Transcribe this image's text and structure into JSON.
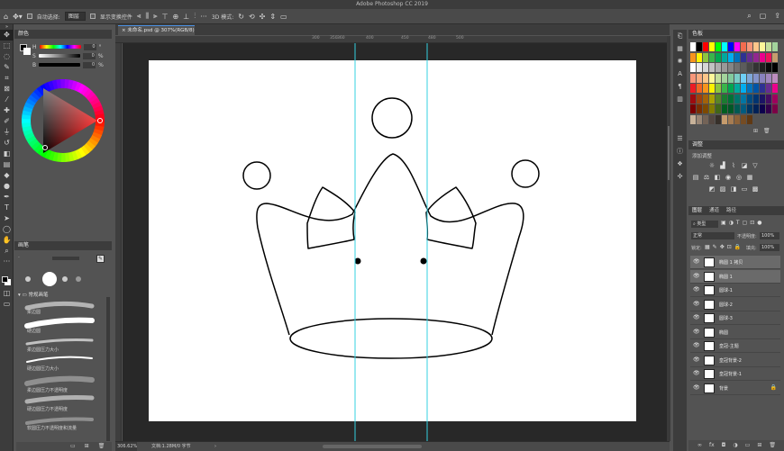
{
  "app": {
    "title": "Adobe Photoshop CC 2019"
  },
  "options_bar": {
    "auto_select_label": "自动选择:",
    "auto_select_value": "图层",
    "show_transform_label": "显示变换控件",
    "mode_3d_label": "3D 模式:"
  },
  "document": {
    "tab_title": "未命名.psd @ 307%(RGB/8) *",
    "zoom": "306.62%",
    "doc_info": "文档:1.28M/0 字节",
    "ruler_labels": [
      "300",
      "350",
      "360",
      "400",
      "450",
      "480",
      "500"
    ]
  },
  "color_panel": {
    "title": "颜色",
    "sliders": [
      {
        "letter": "H",
        "value": "0",
        "unit": "°"
      },
      {
        "letter": "S",
        "value": "0",
        "unit": "%"
      },
      {
        "letter": "B",
        "value": "0",
        "unit": "%"
      }
    ]
  },
  "brush_panel": {
    "title": "画笔",
    "group_name": "常规画笔",
    "brushes": [
      "柔边圆",
      "硬边圆",
      "柔边圆压力大小",
      "硬边圆压力大小",
      "柔边圆压力不透明度",
      "硬边圆压力不透明度",
      "软圆压力不透明度和流量"
    ]
  },
  "swatches_panel": {
    "title": "色板",
    "colors": [
      "#ffffff",
      "#000000",
      "#ff0000",
      "#ffff00",
      "#00ff00",
      "#00ffff",
      "#0000ff",
      "#ff00ff",
      "#f26c4f",
      "#f69679",
      "#fdc68a",
      "#fff799",
      "#c4df9b",
      "#a3d39c",
      "#f7941d",
      "#fff200",
      "#8dc63f",
      "#39b54a",
      "#00a651",
      "#00a99d",
      "#00aeef",
      "#0072bc",
      "#2e3192",
      "#662d91",
      "#92278f",
      "#ec008c",
      "#ed145b",
      "#c69c6d",
      "#ffffff",
      "#ebebeb",
      "#d7d7d7",
      "#c2c2c2",
      "#adadad",
      "#999999",
      "#858585",
      "#707070",
      "#5c5c5c",
      "#474747",
      "#333333",
      "#1f1f1f",
      "#0a0a0a",
      "#000000",
      "#f7977a",
      "#f9ad81",
      "#fdc68a",
      "#fff79a",
      "#c4df9b",
      "#a3d39c",
      "#82ca9d",
      "#7bcdc8",
      "#6ecff6",
      "#7ea7d8",
      "#8493ca",
      "#8882be",
      "#a187be",
      "#bc8dbf",
      "#ed1c24",
      "#f26522",
      "#f7941d",
      "#fff200",
      "#8dc63f",
      "#39b54a",
      "#00a651",
      "#00a99d",
      "#00aeef",
      "#0072bc",
      "#0054a6",
      "#2e3192",
      "#662d91",
      "#ec008c",
      "#9e0b0f",
      "#a0410d",
      "#a36209",
      "#aba000",
      "#598527",
      "#1a7b30",
      "#007236",
      "#00746b",
      "#0076a3",
      "#004b80",
      "#003471",
      "#1b1464",
      "#440e62",
      "#9e005d",
      "#790000",
      "#7b2e00",
      "#7d4900",
      "#827b00",
      "#406618",
      "#005e20",
      "#005826",
      "#005952",
      "#005b7f",
      "#003663",
      "#002157",
      "#0d004c",
      "#32004b",
      "#7b0046",
      "#c7b299",
      "#998675",
      "#736357",
      "#534741",
      "#37302a",
      "#c69c6d",
      "#a67c52",
      "#8c6239",
      "#754c24",
      "#603913"
    ]
  },
  "adjustments_panel": {
    "title": "调整",
    "subtitle": "添加调整"
  },
  "layers_panel": {
    "tabs": [
      "图层",
      "通道",
      "路径"
    ],
    "kind_filter": "类型",
    "blend_mode": "正常",
    "opacity_label": "不透明度:",
    "opacity_value": "100%",
    "lock_label": "锁定:",
    "fill_label": "填充:",
    "fill_value": "100%",
    "layers": [
      {
        "name": "椭圆 1 拷贝",
        "selected": true,
        "locked": false
      },
      {
        "name": "椭圆 1",
        "selected": true,
        "locked": false
      },
      {
        "name": "圆球-1",
        "selected": false,
        "locked": false
      },
      {
        "name": "圆球-2",
        "selected": false,
        "locked": false
      },
      {
        "name": "圆球-3",
        "selected": false,
        "locked": false
      },
      {
        "name": "椭圆",
        "selected": false,
        "locked": false
      },
      {
        "name": "皇冠-主题",
        "selected": false,
        "locked": false
      },
      {
        "name": "皇冠背景-2",
        "selected": false,
        "locked": false
      },
      {
        "name": "皇冠背景-1",
        "selected": false,
        "locked": false
      },
      {
        "name": "背景",
        "selected": false,
        "locked": true
      }
    ]
  },
  "colors": {
    "guide": "#35d0e0",
    "foreground": "#000000",
    "background": "#ffffff"
  }
}
